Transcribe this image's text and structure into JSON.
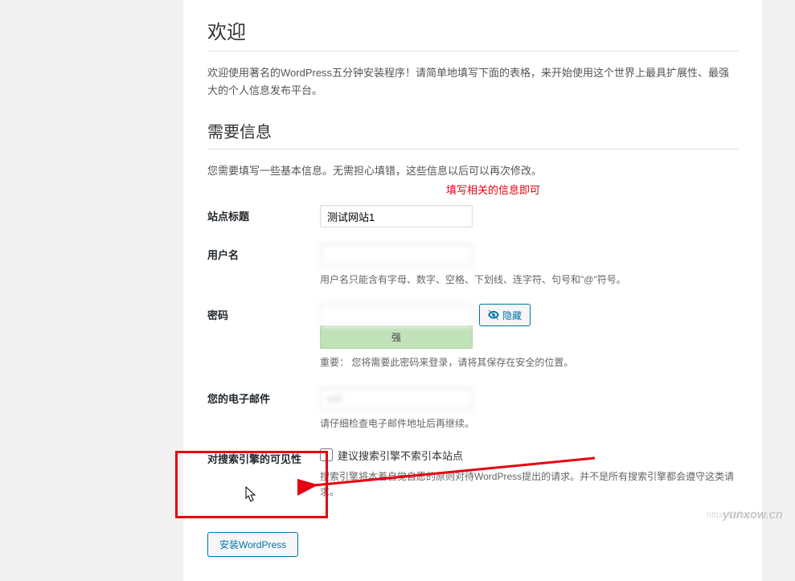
{
  "headings": {
    "welcome": "欢迎",
    "info_needed": "需要信息"
  },
  "intro_text": "欢迎使用著名的WordPress五分钟安装程序！请简单地填写下面的表格，来开始使用这个世界上最具扩展性、最强大的个人信息发布平台。",
  "sub_intro": "您需要填写一些基本信息。无需担心填错，这些信息以后可以再次修改。",
  "annotation_text": "填写相关的信息即可",
  "fields": {
    "site_title": {
      "label": "站点标题",
      "value": "测试网站1"
    },
    "username": {
      "label": "用户名",
      "value": "",
      "note": "用户名只能含有字母、数字、空格、下划线、连字符、句号和\"@\"符号。"
    },
    "password": {
      "label": "密码",
      "value": "",
      "strength": "强",
      "hide_btn": "隐藏",
      "note": "重要： 您将需要此密码来登录，请将其保存在安全的位置。"
    },
    "email": {
      "label": "您的电子邮件",
      "value": "adr",
      "note": "请仔细检查电子邮件地址后再继续。"
    },
    "visibility": {
      "label": "对搜索引擎的可见性",
      "checkbox_label": "建议搜索引擎不索引本站点",
      "note": "搜索引擎将本着自觉自愿的原则对待WordPress提出的请求。并不是所有搜索引擎都会遵守这类请求。"
    }
  },
  "submit_label": "安装WordPress",
  "watermark": "yunxow.cn",
  "watermark2": "https://blog.csdn"
}
